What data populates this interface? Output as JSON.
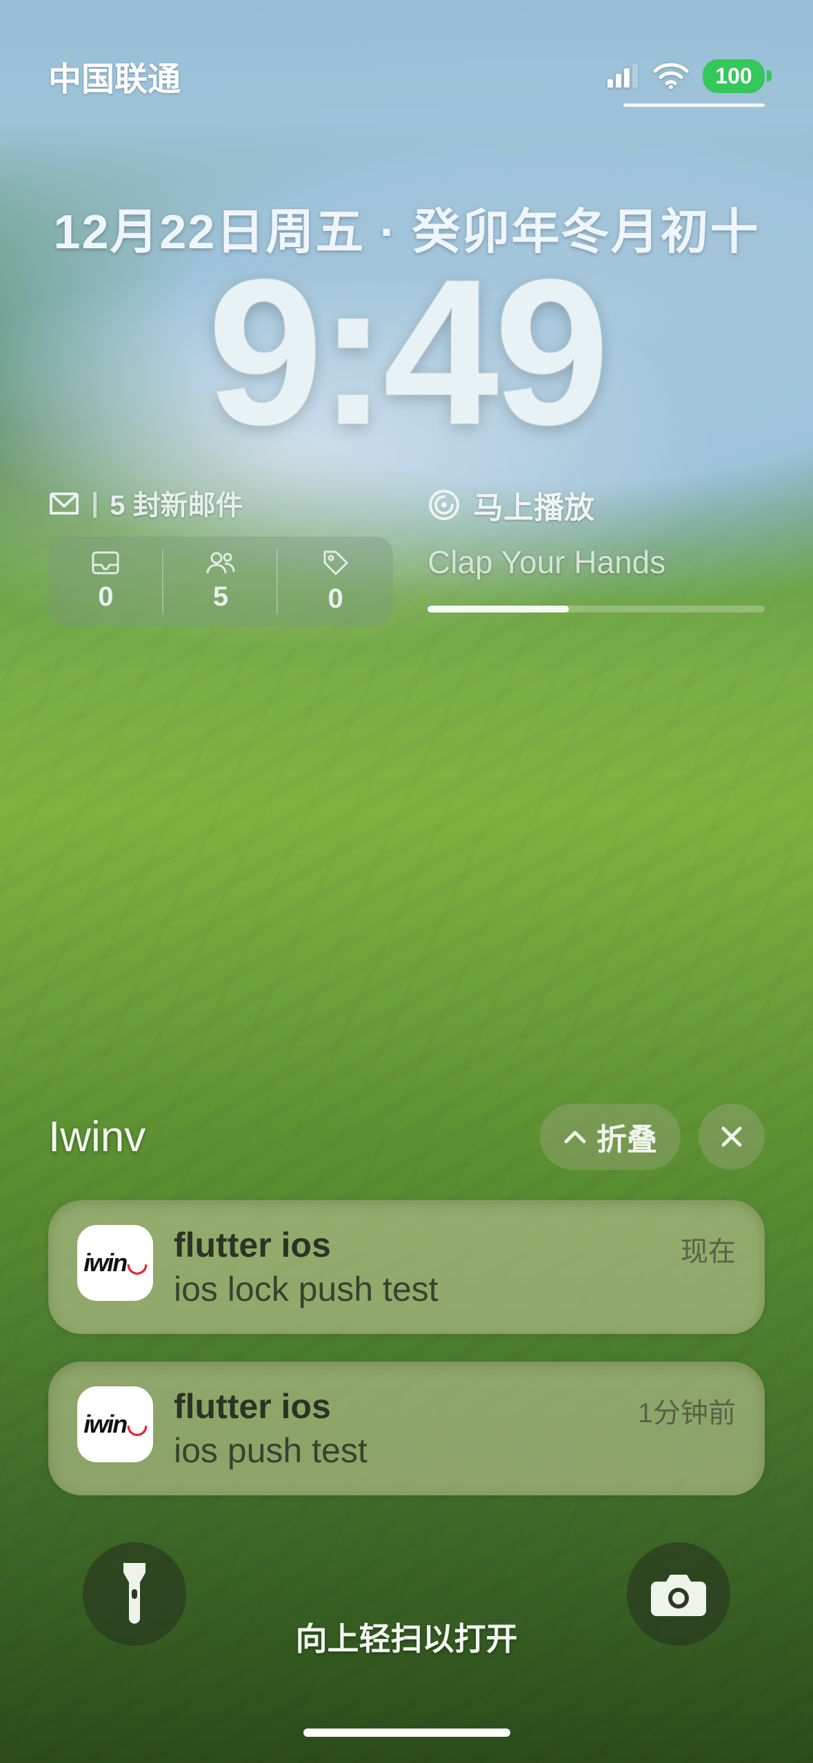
{
  "status": {
    "carrier": "中国联通",
    "battery": "100"
  },
  "date_line": "12月22日周五 · 癸卯年冬月初十",
  "clock": "9:49",
  "mail_widget": {
    "label": "5 封新邮件",
    "cells": [
      {
        "icon": "inbox",
        "value": "0"
      },
      {
        "icon": "people",
        "value": "5"
      },
      {
        "icon": "tag",
        "value": "0"
      }
    ]
  },
  "music_widget": {
    "heading": "马上播放",
    "track": "Clap Your Hands",
    "progress_pct": 42
  },
  "group": {
    "app_name": "Iwinv",
    "collapse_label": "折叠"
  },
  "notifications": [
    {
      "app_icon_text": "iwin",
      "title": "flutter ios",
      "body": "ios lock push test",
      "time": "现在"
    },
    {
      "app_icon_text": "iwin",
      "title": "flutter ios",
      "body": "ios push test",
      "time": "1分钟前"
    }
  ],
  "swipe_hint": "向上轻扫以打开"
}
